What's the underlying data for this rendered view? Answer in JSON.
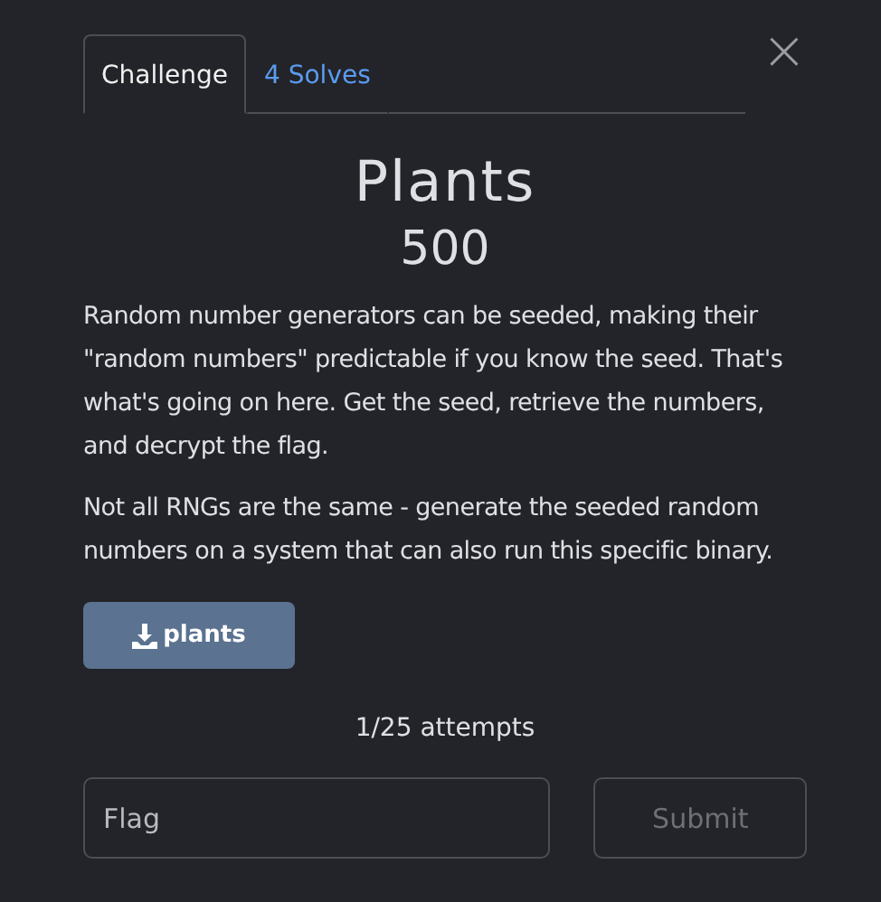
{
  "tabs": [
    {
      "label": "Challenge",
      "selected": true
    },
    {
      "label": "4 Solves",
      "selected": false
    }
  ],
  "close": "×",
  "challenge": {
    "name": "Plants",
    "value": "500",
    "description": [
      "Random number generators can be seeded, making their \"random numbers\" predictable if you know the seed. That's what's going on here. Get the seed, retrieve the numbers, and decrypt the flag.",
      "Not all RNGs are the same - generate the seeded random numbers on a system that can also run this specific binary."
    ],
    "files": [
      "plants"
    ],
    "attempts": "1/25 attempts",
    "flag_field": {
      "placeholder": "Flag"
    },
    "submit": {
      "label": "Submit",
      "disabled": true
    }
  }
}
